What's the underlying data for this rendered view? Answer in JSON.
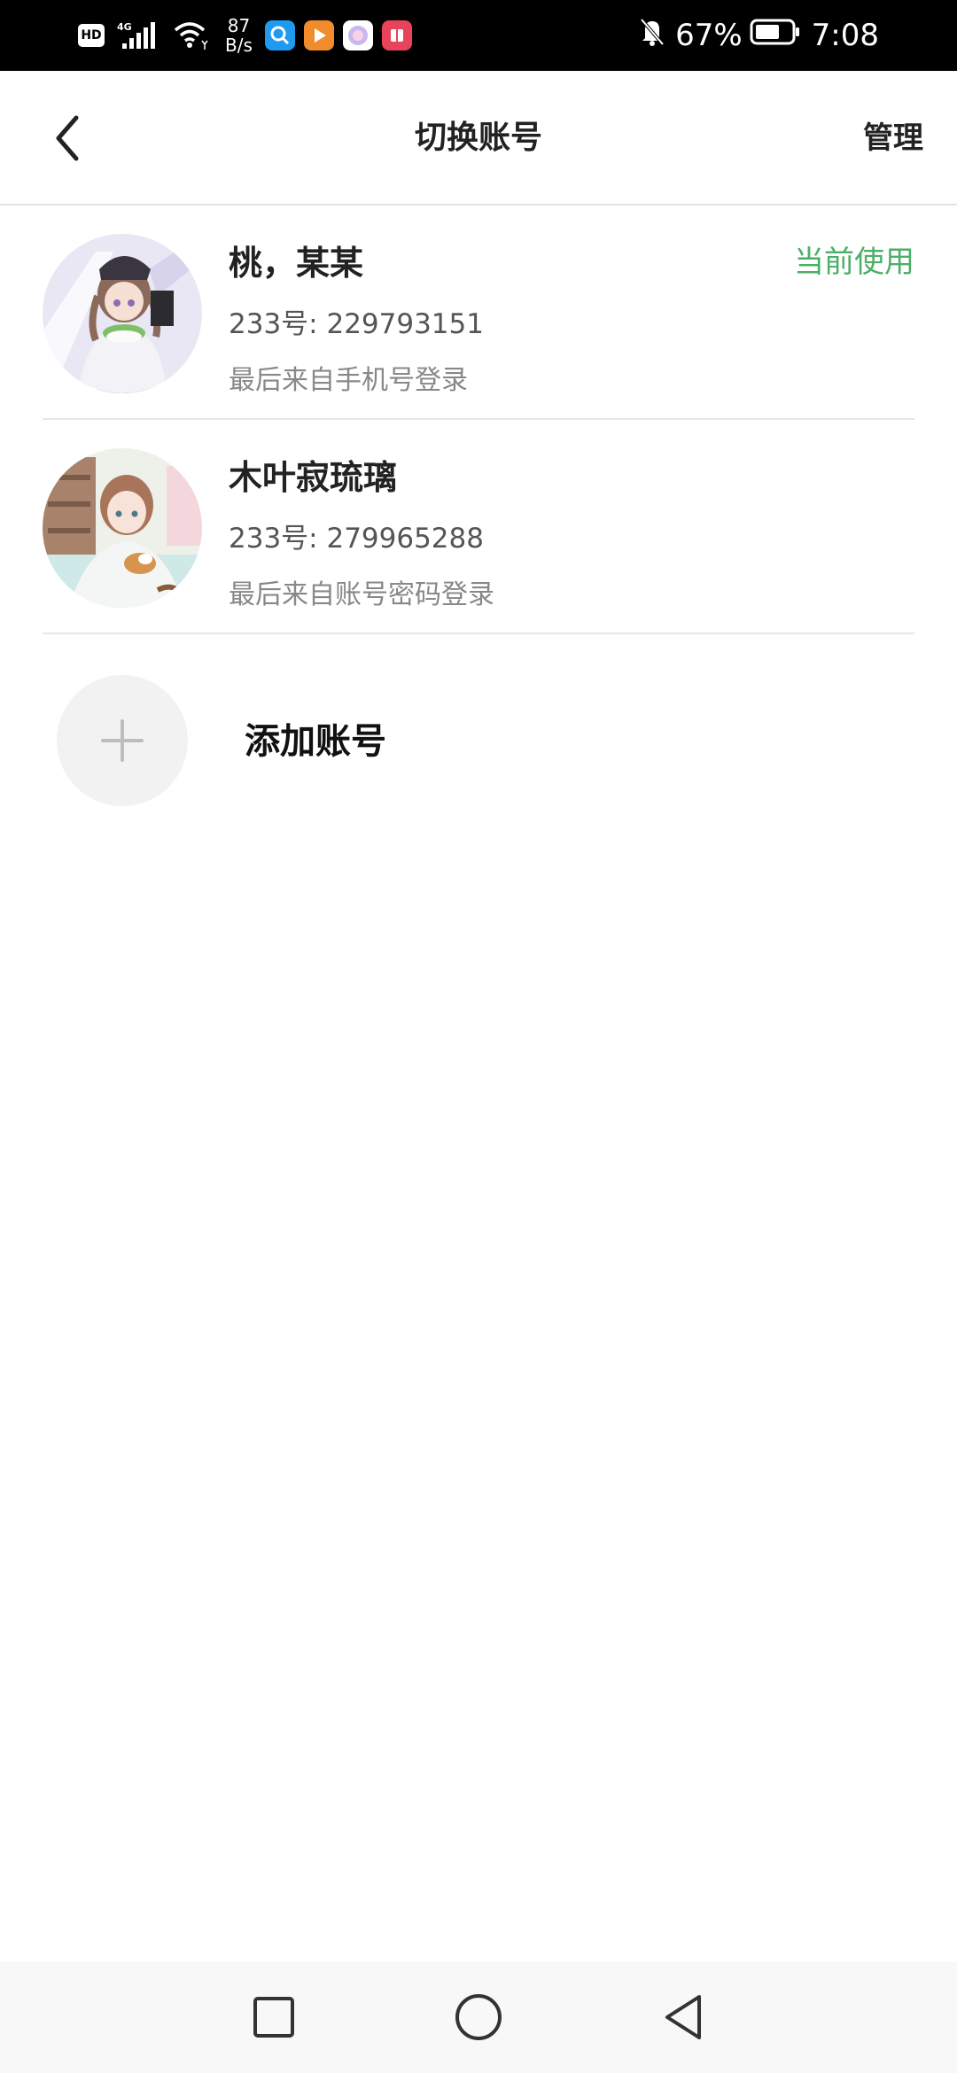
{
  "status_bar": {
    "hd_label": "HD",
    "network_type": "4G",
    "net_speed_value": "87",
    "net_speed_unit": "B/s",
    "battery_percent": "67%",
    "time": "7:08",
    "app_icons": [
      "search-app-icon",
      "video-app-icon",
      "gallery-app-icon",
      "book-app-icon"
    ]
  },
  "header": {
    "title": "切换账号",
    "manage_label": "管理"
  },
  "accounts": [
    {
      "name": "桃，某某",
      "id_label": "233号: 229793151",
      "login_method": "最后来自手机号登录",
      "status": "当前使用"
    },
    {
      "name": "木叶寂琉璃",
      "id_label": "233号: 279965288",
      "login_method": "最后来自账号密码登录",
      "status": ""
    }
  ],
  "add_account": {
    "label": "添加账号"
  },
  "colors": {
    "accent_green": "#4caf68",
    "divider": "#e6e6e6",
    "status_bar_bg": "#000000"
  }
}
